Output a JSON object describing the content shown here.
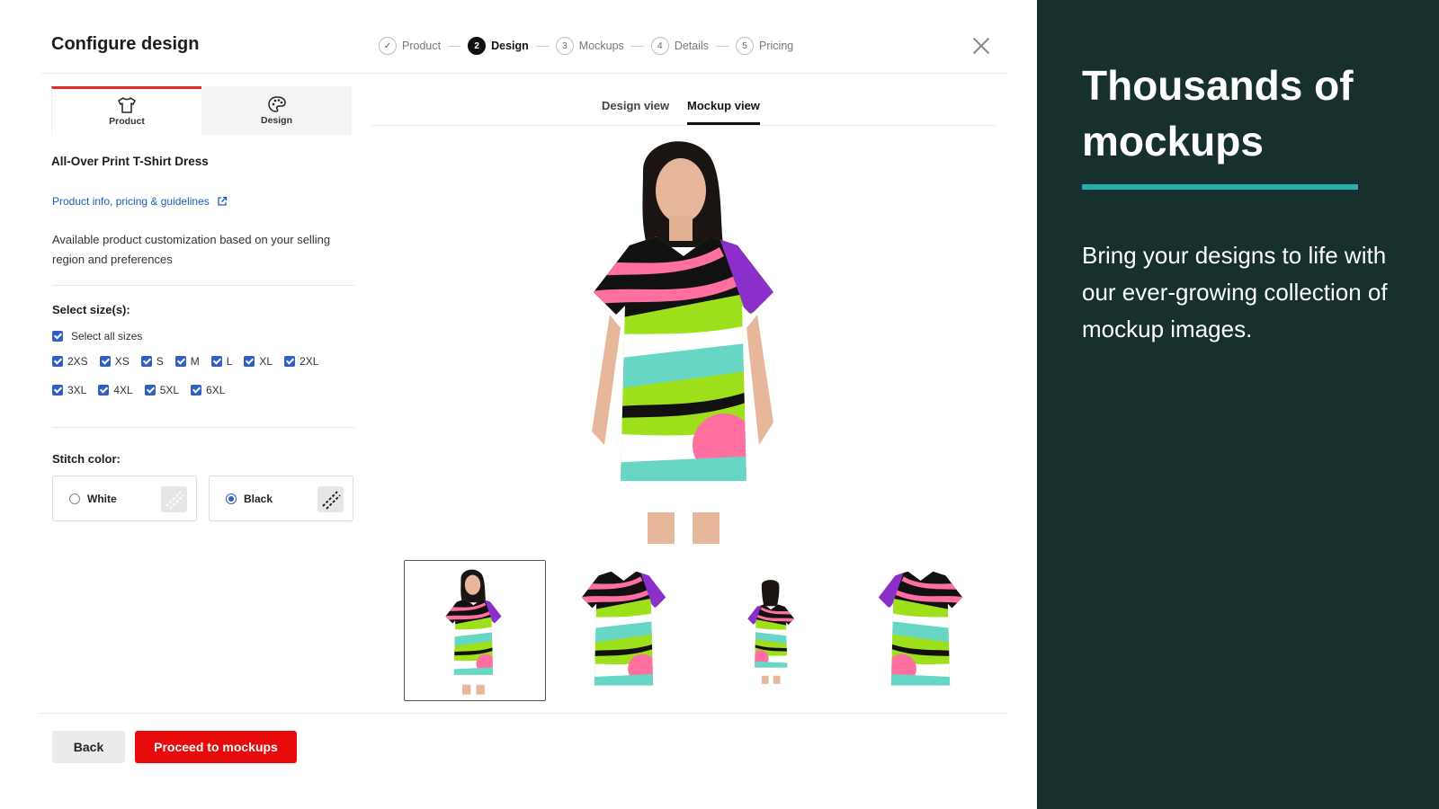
{
  "app": {
    "title": "Configure design",
    "steps": [
      {
        "num": "✓",
        "label": "Product",
        "state": "done"
      },
      {
        "num": "2",
        "label": "Design",
        "state": "active"
      },
      {
        "num": "3",
        "label": "Mockups",
        "state": "upcoming"
      },
      {
        "num": "4",
        "label": "Details",
        "state": "upcoming"
      },
      {
        "num": "5",
        "label": "Pricing",
        "state": "upcoming"
      }
    ],
    "close_icon": "close-icon"
  },
  "panel": {
    "tabs": [
      {
        "label": "Product",
        "icon": "tshirt-icon",
        "active": true
      },
      {
        "label": "Design",
        "icon": "palette-icon",
        "active": false
      }
    ],
    "product_name": "All-Over Print T-Shirt Dress",
    "info_link": "Product info, pricing & guidelines",
    "availability": "Available product customization based on your selling region and preferences",
    "sizes_label": "Select size(s):",
    "select_all": "Select all sizes",
    "sizes_row1": [
      "2XS",
      "XS",
      "S",
      "M",
      "L",
      "XL",
      "2XL"
    ],
    "sizes_row2": [
      "3XL",
      "4XL",
      "5XL",
      "6XL"
    ],
    "stitch_label": "Stitch color:",
    "stitch_options": [
      {
        "label": "White",
        "selected": false
      },
      {
        "label": "Black",
        "selected": true
      }
    ]
  },
  "view": {
    "tabs": [
      {
        "label": "Design view",
        "active": false
      },
      {
        "label": "Mockup view",
        "active": true
      }
    ],
    "thumbnails": [
      "model-front",
      "dress-front-flat",
      "model-back",
      "dress-back-flat"
    ],
    "selected_thumbnail": 0
  },
  "footer": {
    "back": "Back",
    "proceed": "Proceed to mockups"
  },
  "promo": {
    "title": "Thousands of mockups",
    "text": "Bring your designs to life with our ever-growing collection of mockup images.",
    "accent": "#1fb5ad",
    "background": "#17302d"
  },
  "colors": {
    "primary_red": "#e60a0a",
    "checkbox_blue": "#2f5fc0",
    "link_blue": "#1f5bb5"
  }
}
